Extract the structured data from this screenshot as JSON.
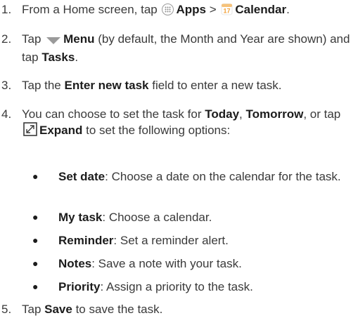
{
  "steps": [
    {
      "num": "1.",
      "t1": "From a Home screen, tap ",
      "apps_icon": "apps-grid-icon",
      "b1": "Apps",
      "t2": " > ",
      "calendar_icon": "calendar-icon",
      "calendar_icon_text": "17",
      "b2": "Calendar",
      "t3": "."
    },
    {
      "num": "2.",
      "t1": "Tap ",
      "menu_icon": "dropdown-triangle-icon",
      "b1": "Menu",
      "t2": " (by default, the Month and Year are shown) and tap ",
      "b2": "Tasks",
      "t3": "."
    },
    {
      "num": "3.",
      "t1": "Tap the ",
      "b1": "Enter new task",
      "t2": " field to enter a new task."
    },
    {
      "num": "4.",
      "t1": "You can choose to set the task for ",
      "b1": "Today",
      "t2": ", ",
      "b2": "Tomorrow",
      "t3": ", or tap ",
      "expand_icon": "expand-icon",
      "b3": "Expand",
      "t4": " to set the following options:"
    },
    {
      "num": "5.",
      "t1": "Tap ",
      "b1": "Save",
      "t2": " to save the task."
    }
  ],
  "options": [
    {
      "label": "Set date",
      "desc": ": Choose a date on the calendar for the task."
    },
    {
      "label": "My task",
      "desc": ": Choose a calendar."
    },
    {
      "label": "Reminder",
      "desc": ": Set a reminder alert."
    },
    {
      "label": "Notes",
      "desc": ": Save a note with your task."
    },
    {
      "label": "Priority",
      "desc": ": Assign a priority to the task."
    }
  ],
  "bullet_char": "●",
  "colors": {
    "text": "#3a3a3a",
    "bold": "#1c1c1c",
    "calendar_icon": "#f2a23a",
    "icon_gray": "#8c8c8c"
  }
}
